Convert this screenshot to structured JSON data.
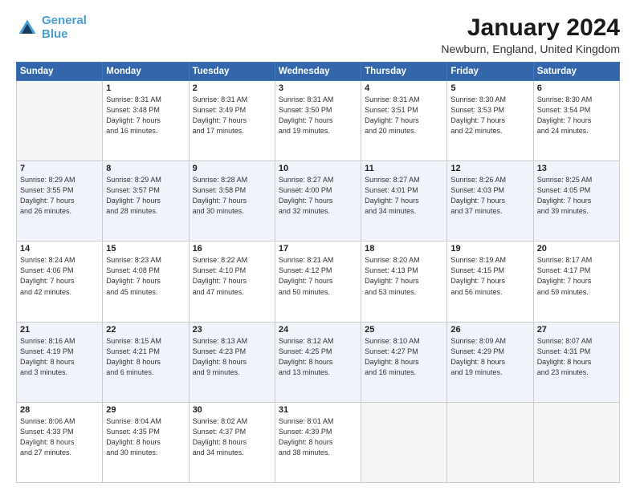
{
  "header": {
    "logo_line1": "General",
    "logo_line2": "Blue",
    "month_title": "January 2024",
    "location": "Newburn, England, United Kingdom"
  },
  "days_of_week": [
    "Sunday",
    "Monday",
    "Tuesday",
    "Wednesday",
    "Thursday",
    "Friday",
    "Saturday"
  ],
  "weeks": [
    [
      {
        "day": "",
        "info": ""
      },
      {
        "day": "1",
        "info": "Sunrise: 8:31 AM\nSunset: 3:48 PM\nDaylight: 7 hours\nand 16 minutes."
      },
      {
        "day": "2",
        "info": "Sunrise: 8:31 AM\nSunset: 3:49 PM\nDaylight: 7 hours\nand 17 minutes."
      },
      {
        "day": "3",
        "info": "Sunrise: 8:31 AM\nSunset: 3:50 PM\nDaylight: 7 hours\nand 19 minutes."
      },
      {
        "day": "4",
        "info": "Sunrise: 8:31 AM\nSunset: 3:51 PM\nDaylight: 7 hours\nand 20 minutes."
      },
      {
        "day": "5",
        "info": "Sunrise: 8:30 AM\nSunset: 3:53 PM\nDaylight: 7 hours\nand 22 minutes."
      },
      {
        "day": "6",
        "info": "Sunrise: 8:30 AM\nSunset: 3:54 PM\nDaylight: 7 hours\nand 24 minutes."
      }
    ],
    [
      {
        "day": "7",
        "info": "Sunrise: 8:29 AM\nSunset: 3:55 PM\nDaylight: 7 hours\nand 26 minutes."
      },
      {
        "day": "8",
        "info": "Sunrise: 8:29 AM\nSunset: 3:57 PM\nDaylight: 7 hours\nand 28 minutes."
      },
      {
        "day": "9",
        "info": "Sunrise: 8:28 AM\nSunset: 3:58 PM\nDaylight: 7 hours\nand 30 minutes."
      },
      {
        "day": "10",
        "info": "Sunrise: 8:27 AM\nSunset: 4:00 PM\nDaylight: 7 hours\nand 32 minutes."
      },
      {
        "day": "11",
        "info": "Sunrise: 8:27 AM\nSunset: 4:01 PM\nDaylight: 7 hours\nand 34 minutes."
      },
      {
        "day": "12",
        "info": "Sunrise: 8:26 AM\nSunset: 4:03 PM\nDaylight: 7 hours\nand 37 minutes."
      },
      {
        "day": "13",
        "info": "Sunrise: 8:25 AM\nSunset: 4:05 PM\nDaylight: 7 hours\nand 39 minutes."
      }
    ],
    [
      {
        "day": "14",
        "info": "Sunrise: 8:24 AM\nSunset: 4:06 PM\nDaylight: 7 hours\nand 42 minutes."
      },
      {
        "day": "15",
        "info": "Sunrise: 8:23 AM\nSunset: 4:08 PM\nDaylight: 7 hours\nand 45 minutes."
      },
      {
        "day": "16",
        "info": "Sunrise: 8:22 AM\nSunset: 4:10 PM\nDaylight: 7 hours\nand 47 minutes."
      },
      {
        "day": "17",
        "info": "Sunrise: 8:21 AM\nSunset: 4:12 PM\nDaylight: 7 hours\nand 50 minutes."
      },
      {
        "day": "18",
        "info": "Sunrise: 8:20 AM\nSunset: 4:13 PM\nDaylight: 7 hours\nand 53 minutes."
      },
      {
        "day": "19",
        "info": "Sunrise: 8:19 AM\nSunset: 4:15 PM\nDaylight: 7 hours\nand 56 minutes."
      },
      {
        "day": "20",
        "info": "Sunrise: 8:17 AM\nSunset: 4:17 PM\nDaylight: 7 hours\nand 59 minutes."
      }
    ],
    [
      {
        "day": "21",
        "info": "Sunrise: 8:16 AM\nSunset: 4:19 PM\nDaylight: 8 hours\nand 3 minutes."
      },
      {
        "day": "22",
        "info": "Sunrise: 8:15 AM\nSunset: 4:21 PM\nDaylight: 8 hours\nand 6 minutes."
      },
      {
        "day": "23",
        "info": "Sunrise: 8:13 AM\nSunset: 4:23 PM\nDaylight: 8 hours\nand 9 minutes."
      },
      {
        "day": "24",
        "info": "Sunrise: 8:12 AM\nSunset: 4:25 PM\nDaylight: 8 hours\nand 13 minutes."
      },
      {
        "day": "25",
        "info": "Sunrise: 8:10 AM\nSunset: 4:27 PM\nDaylight: 8 hours\nand 16 minutes."
      },
      {
        "day": "26",
        "info": "Sunrise: 8:09 AM\nSunset: 4:29 PM\nDaylight: 8 hours\nand 19 minutes."
      },
      {
        "day": "27",
        "info": "Sunrise: 8:07 AM\nSunset: 4:31 PM\nDaylight: 8 hours\nand 23 minutes."
      }
    ],
    [
      {
        "day": "28",
        "info": "Sunrise: 8:06 AM\nSunset: 4:33 PM\nDaylight: 8 hours\nand 27 minutes."
      },
      {
        "day": "29",
        "info": "Sunrise: 8:04 AM\nSunset: 4:35 PM\nDaylight: 8 hours\nand 30 minutes."
      },
      {
        "day": "30",
        "info": "Sunrise: 8:02 AM\nSunset: 4:37 PM\nDaylight: 8 hours\nand 34 minutes."
      },
      {
        "day": "31",
        "info": "Sunrise: 8:01 AM\nSunset: 4:39 PM\nDaylight: 8 hours\nand 38 minutes."
      },
      {
        "day": "",
        "info": ""
      },
      {
        "day": "",
        "info": ""
      },
      {
        "day": "",
        "info": ""
      }
    ]
  ]
}
